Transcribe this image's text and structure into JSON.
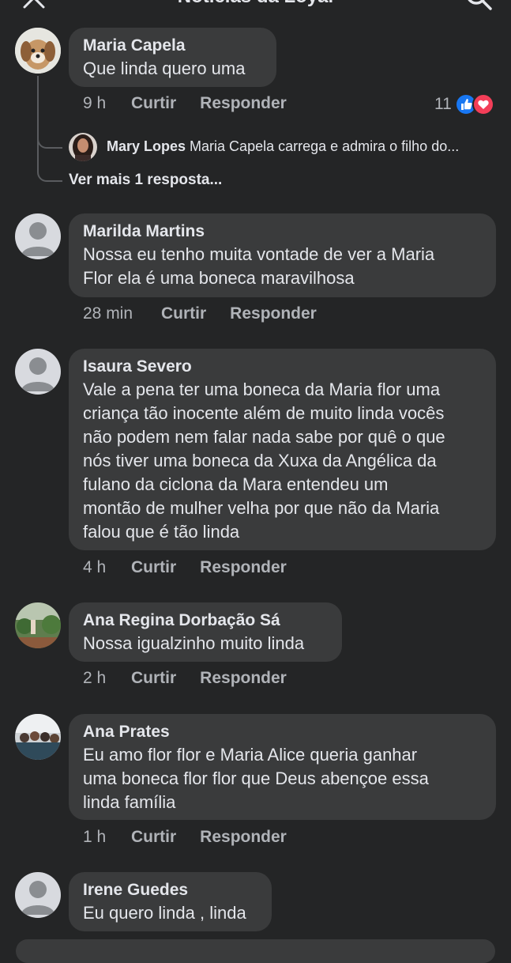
{
  "header": {
    "title": "Notícias da Loyal",
    "close_icon": "close-icon",
    "search_icon": "search-icon"
  },
  "actions": {
    "like": "Curtir",
    "reply": "Responder"
  },
  "comments": [
    {
      "name": "Maria Capela",
      "lines": [
        "Que linda  quero uma"
      ],
      "time": "9 h",
      "reactions": "11"
    },
    {
      "name": "Marilda Martins",
      "lines": [
        "Nossa eu tenho muita vontade de ver a Maria",
        "Flor ela é  uma boneca maravilhosa"
      ],
      "time": "28 min"
    },
    {
      "name": "Isaura Severo",
      "lines": [
        "Vale a pena ter uma boneca da Maria flor uma",
        "criança tão inocente além de muito linda vocês",
        "não podem nem falar nada sabe por quê o que",
        "nós tiver uma boneca da Xuxa da Angélica da",
        "fulano da ciclona da Mara entendeu um",
        "montão de mulher velha por que não da Maria",
        "falou que é tão linda"
      ],
      "time": "4 h"
    },
    {
      "name": "Ana Regina Dorbação Sá",
      "lines": [
        "Nossa igualzinho muito linda"
      ],
      "time": "2 h"
    },
    {
      "name": "Ana Prates",
      "lines": [
        "Eu amo flor flor e Maria Alice queria  ganhar",
        "uma boneca flor flor que Deus abençoe essa",
        "linda família"
      ],
      "time": "1 h"
    },
    {
      "name": "Irene Guedes",
      "lines": [
        "Eu quero linda , linda"
      ]
    }
  ],
  "reply_preview": {
    "name": "Mary Lopes",
    "text": "Maria Capela carrega e admira o filho do..."
  },
  "more_replies": "Ver mais 1 resposta...",
  "colors": {
    "background": "#242526",
    "bubble": "#3a3b3c",
    "text": "#e4e6eb",
    "muted": "#b0b3b8",
    "like_blue": "#1877f2",
    "love_red": "#f33e58"
  }
}
